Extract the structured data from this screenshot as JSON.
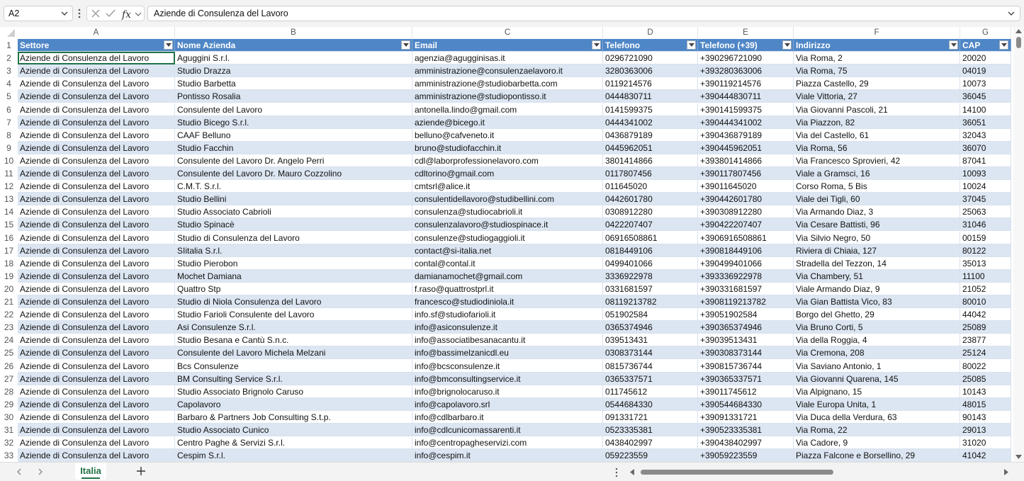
{
  "formula_bar": {
    "name_box": "A2",
    "formula": "Aziende di Consulenza del Lavoro"
  },
  "columns": [
    "A",
    "B",
    "C",
    "D",
    "E",
    "F",
    "G"
  ],
  "header_row_number": "1",
  "headers": [
    "Settore",
    "Nome Azienda",
    "Email",
    "Telefono",
    "Telefono (+39)",
    "Indirizzo",
    "CAP"
  ],
  "rows": [
    [
      "2",
      "Aziende di Consulenza del Lavoro",
      "Aguggini S.r.l.",
      "agenzia@aguggini­sas.it",
      "0296721090",
      "+390296721090",
      "Via Roma, 2",
      "20020"
    ],
    [
      "3",
      "Aziende di Consulenza del Lavoro",
      "Studio Drazza",
      "amministrazione@consulenzaelavoro.it",
      "3280363006",
      "+393280363006",
      "Via Roma, 75",
      "04019"
    ],
    [
      "4",
      "Aziende di Consulenza del Lavoro",
      "Studio Barbetta",
      "amministrazione@studiobarbetta.com",
      "0119214576",
      "+390119214576",
      "Piazza Castello, 29",
      "10073"
    ],
    [
      "5",
      "Aziende di Consulenza del Lavoro",
      "Pontisso Rosalia",
      "amministrazione@studiopontisso.it",
      "0444830711",
      "+390444830711",
      "Viale Vittoria, 27",
      "36045"
    ],
    [
      "6",
      "Aziende di Consulenza del Lavoro",
      "Consulente del Lavoro",
      "antonella.lindo@gmail.com",
      "0141599375",
      "+390141599375",
      "Via Giovanni Pascoli, 21",
      "14100"
    ],
    [
      "7",
      "Aziende di Consulenza del Lavoro",
      "Studio Bicego S.r.l.",
      "aziende@bicego.it",
      "0444341002",
      "+390444341002",
      "Via Piazzon, 82",
      "36051"
    ],
    [
      "8",
      "Aziende di Consulenza del Lavoro",
      "CAAF Belluno",
      "belluno@cafveneto.it",
      "0436879189",
      "+390436879189",
      "Via del Castello, 61",
      "32043"
    ],
    [
      "9",
      "Aziende di Consulenza del Lavoro",
      "Studio Facchin",
      "bruno@studiofacchin.it",
      "0445962051",
      "+390445962051",
      "Via Roma, 56",
      "36070"
    ],
    [
      "10",
      "Aziende di Consulenza del Lavoro",
      "Consulente del Lavoro Dr. Angelo Perri",
      "cdl@laborprofessionelavoro.com",
      "3801414866",
      "+393801414866",
      "Via Francesco Sprovieri, 42",
      "87041"
    ],
    [
      "11",
      "Aziende di Consulenza del Lavoro",
      "Consulente del Lavoro Dr. Mauro Cozzolino",
      "cdltorino@gmail.com",
      "0117807456",
      "+390117807456",
      "Viale a Gramsci, 16",
      "10093"
    ],
    [
      "12",
      "Aziende di Consulenza del Lavoro",
      "C.M.T. S.r.l.",
      "cmtsrl@alice.it",
      "011645020",
      "+39011645020",
      "Corso Roma, 5 Bis",
      "10024"
    ],
    [
      "13",
      "Aziende di Consulenza del Lavoro",
      "Studio Bellini",
      "consulentidellavoro@studibellini.com",
      "0442601780",
      "+390442601780",
      "Viale dei Tigli, 60",
      "37045"
    ],
    [
      "14",
      "Aziende di Consulenza del Lavoro",
      "Studio Associato Cabrioli",
      "consulenza@studiocabrioli.it",
      "0308912280",
      "+390308912280",
      "Via Armando Diaz, 3",
      "25063"
    ],
    [
      "15",
      "Aziende di Consulenza del Lavoro",
      "Studio Spinacè",
      "consulenzalavoro@studiospinace.it",
      "0422207407",
      "+390422207407",
      "Via Cesare Battisti, 96",
      "31046"
    ],
    [
      "16",
      "Aziende di Consulenza del Lavoro",
      "Studio di Consulenza del Lavoro",
      "consulenze@studiogaggioli.it",
      "06916508861",
      "+3906916508861",
      "Via Silvio Negro, 50",
      "00159"
    ],
    [
      "17",
      "Aziende di Consulenza del Lavoro",
      "SIitalia S.r.l.",
      "contact@si-italia.net",
      "0818449106",
      "+390818449106",
      "Riviera di Chiaia, 127",
      "80122"
    ],
    [
      "18",
      "Aziende di Consulenza del Lavoro",
      "Studio Pierobon",
      "contal@contal.it",
      "0499401066",
      "+390499401066",
      "Stradella del Tezzon, 14",
      "35013"
    ],
    [
      "19",
      "Aziende di Consulenza del Lavoro",
      "Mochet Damiana",
      "damianamochet@gmail.com",
      "3336922978",
      "+393336922978",
      "Via Chambery, 51",
      "11100"
    ],
    [
      "20",
      "Aziende di Consulenza del Lavoro",
      "Quattro Stp",
      "f.raso@quattrostprl.it",
      "0331681597",
      "+390331681597",
      "Viale Armando Diaz, 9",
      "21052"
    ],
    [
      "21",
      "Aziende di Consulenza del Lavoro",
      "Studio di Niola Consulenza del Lavoro",
      "francesco@studiodiniola.it",
      "08119213782",
      "+3908119213782",
      "Via Gian Battista Vico, 83",
      "80010"
    ],
    [
      "22",
      "Aziende di Consulenza del Lavoro",
      "Studio Farioli Consulente del Lavoro",
      "info.sf@studiofarioli.it",
      "051902584",
      "+39051902584",
      "Borgo del Ghetto, 29",
      "44042"
    ],
    [
      "23",
      "Aziende di Consulenza del Lavoro",
      "Asi Consulenze S.r.l.",
      "info@asiconsulenze.it",
      "0365374946",
      "+390365374946",
      "Via Bruno Corti, 5",
      "25089"
    ],
    [
      "24",
      "Aziende di Consulenza del Lavoro",
      "Studio Besana e Cantù S.n.c.",
      "info@associatibesanacantu.it",
      "039513431",
      "+39039513431",
      "Via della Roggia, 4",
      "23877"
    ],
    [
      "25",
      "Aziende di Consulenza del Lavoro",
      "Consulente del Lavoro Michela Melzani",
      "info@bassimelzanicdl.eu",
      "0308373144",
      "+390308373144",
      "Via Cremona, 208",
      "25124"
    ],
    [
      "26",
      "Aziende di Consulenza del Lavoro",
      "Bcs Consulenze",
      "info@bcsconsulenze.it",
      "0815736744",
      "+390815736744",
      "Via Saviano Antonio, 1",
      "80022"
    ],
    [
      "27",
      "Aziende di Consulenza del Lavoro",
      "BM Consulting Service S.r.l.",
      "info@bmconsultingservice.it",
      "0365337571",
      "+390365337571",
      "Via Giovanni Quarena, 145",
      "25085"
    ],
    [
      "28",
      "Aziende di Consulenza del Lavoro",
      "Studio Associato Brignolo Caruso",
      "info@brignolocaruso.it",
      "011745612",
      "+39011745612",
      "Via Alpignano, 15",
      "10143"
    ],
    [
      "29",
      "Aziende di Consulenza del Lavoro",
      "Capolavoro",
      "info@capolavoro.srl",
      "0544684330",
      "+390544684330",
      "Viale Europa Unita, 1",
      "48015"
    ],
    [
      "30",
      "Aziende di Consulenza del Lavoro",
      "Barbaro & Partners Job Consulting S.t.p.",
      "info@cdlbarbaro.it",
      "091331721",
      "+39091331721",
      "Via Duca della Verdura, 63",
      "90143"
    ],
    [
      "31",
      "Aziende di Consulenza del Lavoro",
      "Studio Associato Cunico",
      "info@cdlcunicomassarenti.it",
      "0523335381",
      "+390523335381",
      "Via Roma, 22",
      "29013"
    ],
    [
      "32",
      "Aziende di Consulenza del Lavoro",
      "Centro Paghe & Servizi S.r.l.",
      "info@centropagheservizi.com",
      "0438402997",
      "+390438402997",
      "Via Cadore, 9",
      "31020"
    ],
    [
      "33",
      "Aziende di Consulenza del Lavoro",
      "Cespim S.r.l.",
      "info@cespim.it",
      "059223559",
      "+39059223559",
      "Piazza Falcone e Borsellino, 29",
      "41042"
    ]
  ],
  "sheet_tab": "Italia",
  "colors": {
    "header_fill": "#4e86c6",
    "band_fill": "#dce6f2",
    "accent": "#217346"
  }
}
